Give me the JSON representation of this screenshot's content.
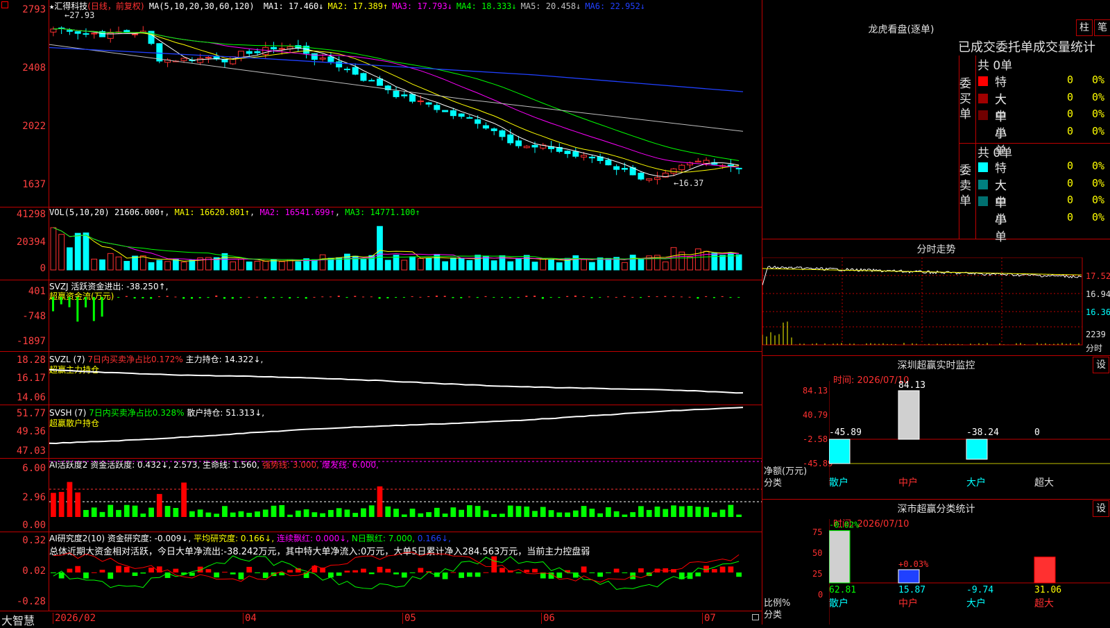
{
  "app": {
    "brand": "大智慧"
  },
  "main_chart": {
    "title_star": "★",
    "stock_name": "汇得科技",
    "mode": "(日线，前复权)",
    "ma_label": "MA(5,10,20,30,60,120)",
    "ma": [
      {
        "label": "MA1:",
        "value": "17.460",
        "arrow": "↓",
        "color": "#ffffff"
      },
      {
        "label": "MA2:",
        "value": "17.389",
        "arrow": "↑",
        "color": "#ffff00"
      },
      {
        "label": "MA3:",
        "value": "17.793",
        "arrow": "↓",
        "color": "#ff00ff"
      },
      {
        "label": "MA4:",
        "value": "18.333",
        "arrow": "↓",
        "color": "#00ff00"
      },
      {
        "label": "MA5:",
        "value": "20.458",
        "arrow": "↓",
        "color": "#c0c0c0"
      },
      {
        "label": "MA6:",
        "value": "22.952",
        "arrow": "↓",
        "color": "#2040ff"
      }
    ],
    "y_ticks": [
      "2793",
      "2408",
      "2022",
      "1637"
    ],
    "high_mark": "27.93",
    "low_mark": "16.37",
    "x_ticks": [
      "2026/02",
      "04",
      "05",
      "06",
      "07"
    ]
  },
  "vol_panel": {
    "label": "VOL(5,10,20)",
    "value": "21606.000↑",
    "ma": [
      {
        "text": "MA1: 16620.801↑",
        "color": "#ffff00"
      },
      {
        "text": "MA2: 16541.699↑",
        "color": "#ff00ff"
      },
      {
        "text": "MA3: 14771.100↑",
        "color": "#00ff00"
      }
    ],
    "y_ticks": [
      "41298",
      "20394",
      "0"
    ]
  },
  "svzj_panel": {
    "label": "SVZJ  活跃资金进出: -38.250↑,",
    "sub": "超赢资金流(万元)",
    "y_ticks": [
      "401",
      "-748",
      "-1897"
    ]
  },
  "svzl_panel": {
    "label": "SVZL (7)",
    "desc": "7日内买卖净占比0.172%",
    "hold": "主力持仓: 14.322↓,",
    "sub": "超赢主力持仓",
    "y_ticks": [
      "18.28",
      "16.17",
      "14.06"
    ]
  },
  "svsh_panel": {
    "label": "SVSH (7)",
    "desc": "7日内买卖净占比0.328%",
    "hold": "散户持仓: 51.313↓,",
    "sub": "超赢散户持仓",
    "y_ticks": [
      "51.77",
      "49.36",
      "47.03"
    ]
  },
  "ai_active_panel": {
    "label": "AI活跃度2 资金活跃度: 0.432↓, 2.573,",
    "life": "生命线: 1.560,",
    "strong": "强势线: 3.000,",
    "burst": "爆发线: 6.000,",
    "y_ticks": [
      "6.00",
      "2.96",
      "0.00"
    ]
  },
  "ai_research_panel": {
    "label": "AI研究度2(10) 资金研究度: -0.009↓,",
    "avg": "平均研究度: 0.166↓,",
    "red": "连续飘红: 0.000↓,",
    "nday": "N日飘红: 7.000,",
    "tail": "0.166↓,",
    "summary": "总体近期大资金相对活跃，今日大单净流出:-38.242万元，其中特大单净流入:0万元，大单5日累计净入284.563万元，当前主力控盘弱",
    "y_ticks": [
      "0.32",
      "0.02",
      "-0.28"
    ]
  },
  "dragon": {
    "title": "龙虎看盘(逐单)",
    "btn_col": "柱",
    "btn_pen": "笔",
    "subtitle": "已成交委托单成交量统计",
    "buy": {
      "side_label": "委买单",
      "total": "共 0单",
      "rows": [
        {
          "name": "特大",
          "count": "0",
          "pct": "0%",
          "color": "#ff0000"
        },
        {
          "name": "大单",
          "count": "0",
          "pct": "0%",
          "color": "#a00000"
        },
        {
          "name": "中单",
          "count": "0",
          "pct": "0%",
          "color": "#700000"
        },
        {
          "name": "小单",
          "count": "0",
          "pct": "0%",
          "color": "#000000"
        }
      ]
    },
    "sell": {
      "side_label": "委卖单",
      "total": "共 0单",
      "rows": [
        {
          "name": "特大",
          "count": "0",
          "pct": "0%",
          "color": "#00ffff"
        },
        {
          "name": "大单",
          "count": "0",
          "pct": "0%",
          "color": "#008080"
        },
        {
          "name": "中单",
          "count": "0",
          "pct": "0%",
          "color": "#007070"
        },
        {
          "name": "小单",
          "count": "0",
          "pct": "0%",
          "color": "#000000"
        }
      ]
    }
  },
  "intraday": {
    "title": "分时走势",
    "y_ticks": [
      "17.52",
      "16.94",
      "16.36"
    ],
    "vol_label": "2239",
    "vol_unit": "分时"
  },
  "monitor": {
    "title": "深圳超赢实时监控",
    "btn": "设",
    "time": "时间: 2026/07/10",
    "y_ticks": [
      "84.13",
      "40.79",
      "-2.58",
      "-45.89"
    ],
    "unit": "净额(万元)",
    "cat_label": "分类",
    "categories": [
      "散户",
      "中户",
      "大户",
      "超大"
    ],
    "values": [
      "-45.89",
      "84.13",
      "-38.24",
      "0"
    ],
    "chart_data": {
      "type": "bar",
      "categories": [
        "散户",
        "中户",
        "大户",
        "超大"
      ],
      "values": [
        -45.89,
        84.13,
        -38.24,
        0
      ],
      "ylabel": "净额(万元)",
      "ylim": [
        -45.89,
        84.13
      ]
    }
  },
  "classify": {
    "title": "深市超赢分类统计",
    "btn": "设",
    "time": "时间: 2026/07/10",
    "y_ticks": [
      "75",
      "50",
      "25",
      "0"
    ],
    "unit": "比例%",
    "cat_label": "分类",
    "categories": [
      "散户",
      "中户",
      "大户",
      "超大"
    ],
    "top_labels": [
      "-0.02%",
      "+0.03%",
      "",
      ""
    ],
    "bottom_values": [
      "62.81",
      "15.87",
      "-9.74",
      "31.06"
    ],
    "chart_data": {
      "type": "bar",
      "categories": [
        "散户",
        "中户",
        "大户",
        "超大"
      ],
      "values": [
        62.81,
        15.87,
        -9.74,
        31.06
      ],
      "ylabel": "比例%",
      "ylim": [
        0,
        75
      ]
    }
  }
}
